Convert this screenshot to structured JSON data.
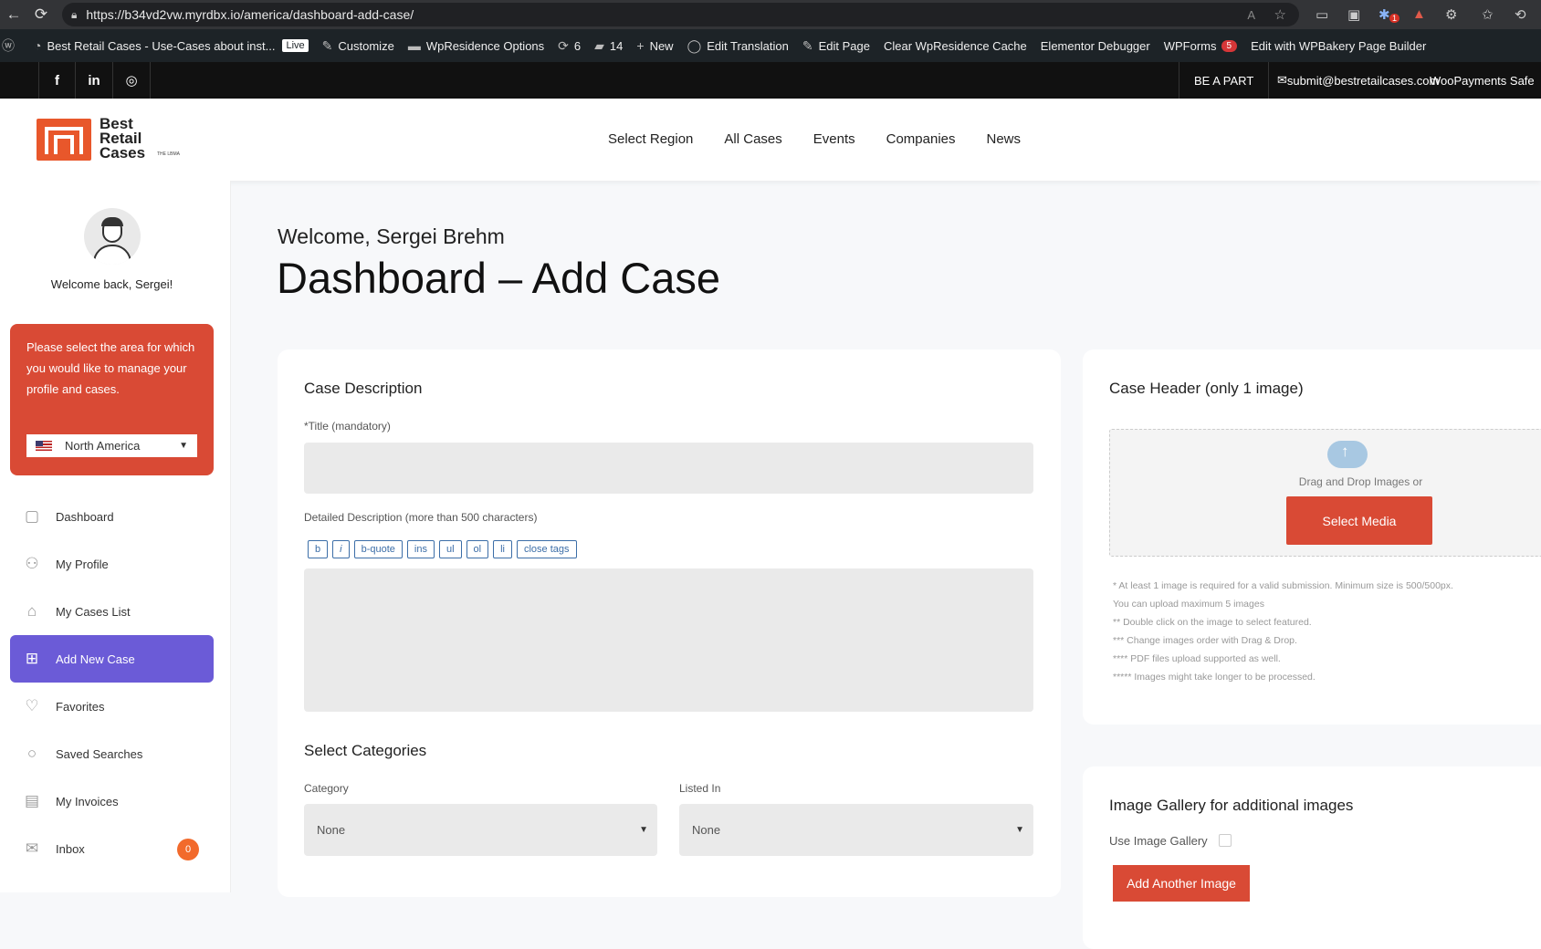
{
  "browser": {
    "url": "https://b34vd2vw.myrdbx.io/america/dashboard-add-case/"
  },
  "adminbar": {
    "site": "Best Retail Cases - Use-Cases about inst...",
    "live": "Live",
    "customize": "Customize",
    "wpresidence_options": "WpResidence Options",
    "updates": "6",
    "comments": "14",
    "new": "New",
    "edit_translation": "Edit Translation",
    "edit_page": "Edit Page",
    "clear_cache": "Clear WpResidence Cache",
    "elementor": "Elementor Debugger",
    "wpforms": "WPForms",
    "wpforms_count": "5",
    "wpbakery": "Edit with WPBakery Page Builder"
  },
  "topbar": {
    "be_a_part": "BE A PART",
    "email": "submit@bestretailcases.com",
    "woo": "WooPayments Safe"
  },
  "header": {
    "logo_lines": [
      "Best",
      "Retail",
      "Cases"
    ],
    "logo_sub": "THE LBMA",
    "nav": [
      "Select Region",
      "All Cases",
      "Events",
      "Companies",
      "News"
    ]
  },
  "sidebar": {
    "welcome_back": "Welcome back, Sergei!",
    "region_prompt": "Please select the area for which you would like to manage your profile and cases.",
    "region_value": "North America",
    "menu": [
      {
        "label": "Dashboard",
        "icon": "dashboard-icon"
      },
      {
        "label": "My Profile",
        "icon": "user-icon"
      },
      {
        "label": "My Cases List",
        "icon": "home-icon"
      },
      {
        "label": "Add New Case",
        "icon": "plus-square-icon"
      },
      {
        "label": "Favorites",
        "icon": "heart-icon"
      },
      {
        "label": "Saved Searches",
        "icon": "search-icon"
      },
      {
        "label": "My Invoices",
        "icon": "document-icon"
      },
      {
        "label": "Inbox",
        "icon": "mail-icon"
      }
    ],
    "inbox_count": "0"
  },
  "main": {
    "welcome": "Welcome, Sergei Brehm",
    "title": "Dashboard – Add Case",
    "case_description": "Case Description",
    "title_label": "*Title (mandatory)",
    "desc_label": "Detailed Description (more than 500 characters)",
    "quicktags": [
      "b",
      "i",
      "b-quote",
      "ins",
      "ul",
      "ol",
      "li",
      "close tags"
    ],
    "select_categories": "Select Categories",
    "category_label": "Category",
    "category_value": "None",
    "listed_label": "Listed In",
    "listed_value": "None",
    "case_header": "Case Header (only 1 image)",
    "drag_drop": "Drag and Drop Images or",
    "select_media": "Select Media",
    "notes": [
      "* At least 1 image is required for a valid submission. Minimum size is 500/500px.",
      "You can upload maximum 5 images",
      "** Double click on the image to select featured.",
      "*** Change images order with Drag & Drop.",
      "**** PDF files upload supported as well.",
      "***** Images might take longer to be processed."
    ],
    "gallery_title": "Image Gallery for additional images",
    "use_gallery": "Use Image Gallery",
    "add_another": "Add Another Image"
  },
  "colors": {
    "accent": "#d94a35",
    "active": "#6b5bd7",
    "badge": "#f26a2c"
  }
}
